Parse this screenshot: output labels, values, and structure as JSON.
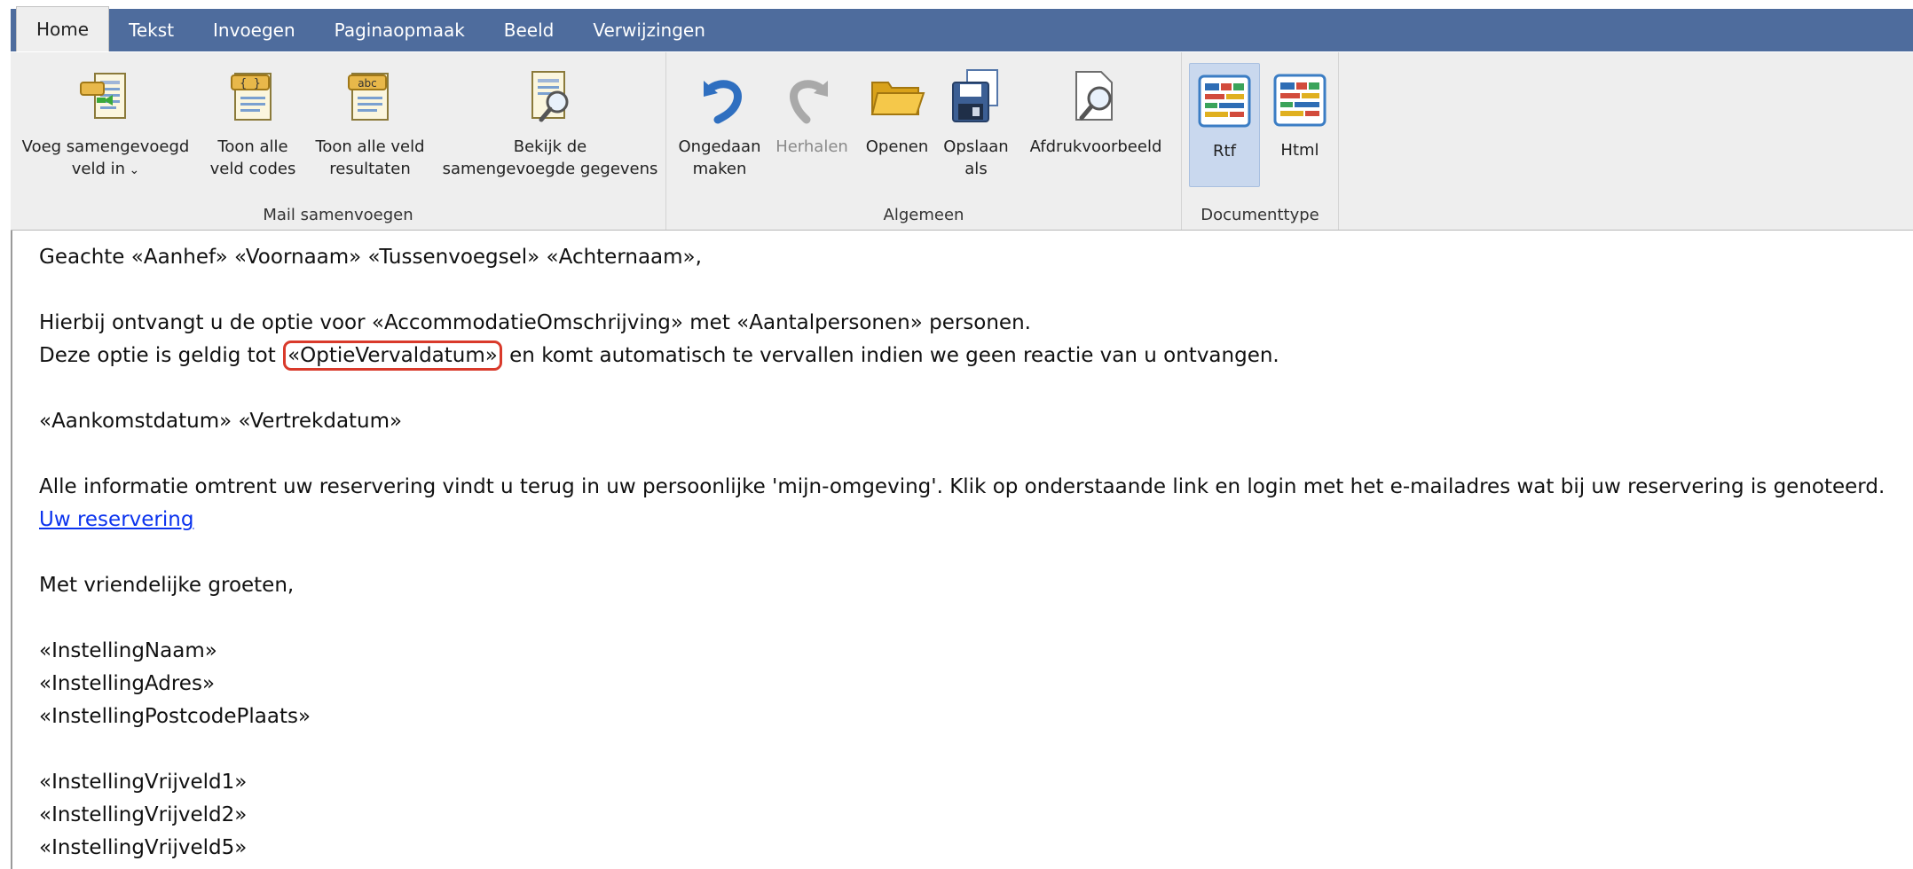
{
  "tabs": [
    "Home",
    "Tekst",
    "Invoegen",
    "Paginaopmaak",
    "Beeld",
    "Verwijzingen"
  ],
  "ribbon": {
    "mail": {
      "label": "Mail samenvoegen",
      "insert_field": "Voeg samengevoegd\nveld in",
      "show_codes": "Toon alle\nveld codes",
      "show_results": "Toon alle veld\nresultaten",
      "view_merged": "Bekijk de\nsamengevoegde gegevens"
    },
    "general": {
      "label": "Algemeen",
      "undo": "Ongedaan\nmaken",
      "redo": "Herhalen",
      "open": "Openen",
      "save_as": "Opslaan\nals",
      "print_preview": "Afdrukvoorbeeld"
    },
    "doctype": {
      "label": "Documenttype",
      "rtf": "Rtf",
      "html": "Html",
      "selected": "Rtf"
    }
  },
  "document": {
    "greeting": "Geachte «Aanhef» «Voornaam» «Tussenvoegsel» «Achternaam»,",
    "line_option": "Hierbij ontvangt u de optie voor «AccommodatieOmschrijving» met «Aantalpersonen» personen.",
    "validity_before": "Deze optie is geldig tot ",
    "validity_field": "«OptieVervaldatum»",
    "validity_after": " en komt automatisch te vervallen indien we geen reactie van u ontvangen.",
    "dates": "«Aankomstdatum» «Vertrekdatum»",
    "info": "Alle informatie omtrent uw reservering vindt u terug in uw persoonlijke 'mijn-omgeving'. Klik op onderstaande link en login met het e-mailadres wat bij uw reservering is genoteerd.",
    "link": "Uw reservering",
    "closing": "Met vriendelijke groeten,",
    "org_name": "«InstellingNaam»",
    "org_address": "«InstellingAdres»",
    "org_postcode": "«InstellingPostcodePlaats»",
    "free1": "«InstellingVrijveld1»",
    "free2": "«InstellingVrijveld2»",
    "free5": "«InstellingVrijveld5»"
  },
  "colors": {
    "tabbar": "#4e6c9d",
    "ribbon": "#eeeeee",
    "highlight": "#d93a2b",
    "link": "#0b33ee"
  }
}
